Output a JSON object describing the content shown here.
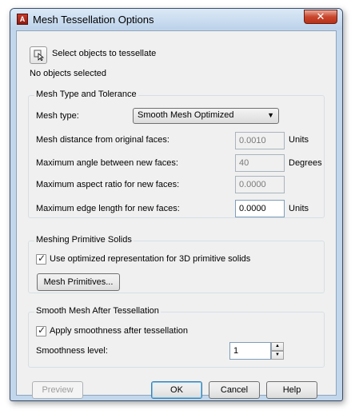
{
  "window": {
    "title": "Mesh Tessellation Options",
    "close_label": "✕",
    "icon_text": "A"
  },
  "select_objects": {
    "label": "Select objects to tessellate",
    "status": "No objects selected"
  },
  "mesh_type_group": {
    "title": "Mesh Type and Tolerance",
    "mesh_type_label": "Mesh type:",
    "mesh_type_value": "Smooth Mesh Optimized",
    "distance_label": "Mesh distance from original faces:",
    "distance_value": "0.0010",
    "distance_unit": "Units",
    "angle_label": "Maximum angle between new faces:",
    "angle_value": "40",
    "angle_unit": "Degrees",
    "aspect_label": "Maximum aspect ratio for new faces:",
    "aspect_value": "0.0000",
    "edge_label": "Maximum edge length for new faces:",
    "edge_value": "0.0000",
    "edge_unit": "Units"
  },
  "primitive_group": {
    "title": "Meshing Primitive Solids",
    "optimized_label": "Use optimized representation for 3D primitive solids",
    "optimized_checked": true,
    "mesh_primitives_button": "Mesh Primitives..."
  },
  "smooth_group": {
    "title": "Smooth Mesh After Tessellation",
    "apply_label": "Apply smoothness after tessellation",
    "apply_checked": true,
    "level_label": "Smoothness level:",
    "level_value": "1"
  },
  "footer": {
    "preview": "Preview",
    "ok": "OK",
    "cancel": "Cancel",
    "help": "Help"
  }
}
